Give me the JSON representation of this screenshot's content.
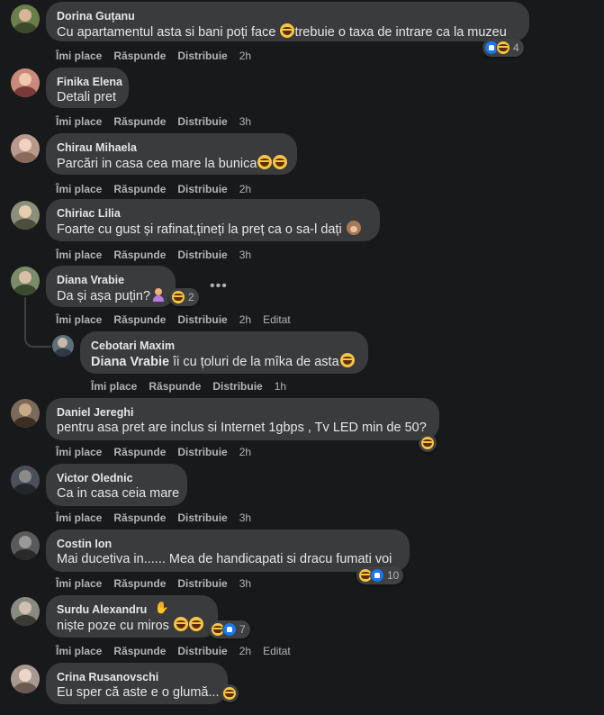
{
  "actions": {
    "like": "Îmi place",
    "reply": "Răspunde",
    "share": "Distribuie",
    "edited": "Editat"
  },
  "comments": [
    {
      "name": "Dorina Guțanu",
      "text_a": "Cu apartamentul asta si bani poți face ",
      "text_b": "trebuie o taxa de intrare ca la muzeu",
      "time": "2h",
      "reaction_count": "4",
      "avatar_color": "#6b7f4a"
    },
    {
      "name": "Finika Elena",
      "text": "Detali pret",
      "time": "3h",
      "avatar_color": "#c98a7a"
    },
    {
      "name": "Chirau Mihaela",
      "text": "Parcări in casa cea mare la bunica",
      "time": "2h",
      "avatar_color": "#b79a8c"
    },
    {
      "name": "Chiriac Lilia",
      "text": "Foarte cu gust și rafinat,țineți la preț ca o sa-l dați ",
      "time": "3h",
      "avatar_color": "#8c8f7a"
    },
    {
      "name": "Diana Vrabie",
      "text": "Da și așa puțin?",
      "time": "2h",
      "reaction_count": "2",
      "avatar_color": "#7a8c6a"
    },
    {
      "name": "Cebotari Maxim",
      "mention": "Diana Vrabie",
      "text": " îi cu țoluri de la mîka de asta",
      "time": "1h",
      "avatar_color": "#5e6f7a"
    },
    {
      "name": "Daniel Jereghi",
      "text": "pentru asa pret are inclus si Internet 1gbps , Tv LED min de 50?",
      "time": "2h",
      "avatar_color": "#7a6a5a"
    },
    {
      "name": "Victor Olednic",
      "text": "Ca in casa ceia mare",
      "time": "3h",
      "avatar_color": "#4a5058"
    },
    {
      "name": "Costin Ion",
      "text": "Mai ducetiva in...... Mea de handicapati si dracu fumati voi",
      "time": "3h",
      "reaction_count": "10",
      "avatar_color": "#5a5a5a"
    },
    {
      "name": "Surdu Alexandru",
      "text": "niște poze cu miros ",
      "time": "2h",
      "reaction_count": "7",
      "avatar_color": "#8a8a80"
    },
    {
      "name": "Crina Rusanovschi",
      "text": "Eu sper că aste e o glumă...",
      "time": "",
      "avatar_color": "#a89a90"
    }
  ]
}
